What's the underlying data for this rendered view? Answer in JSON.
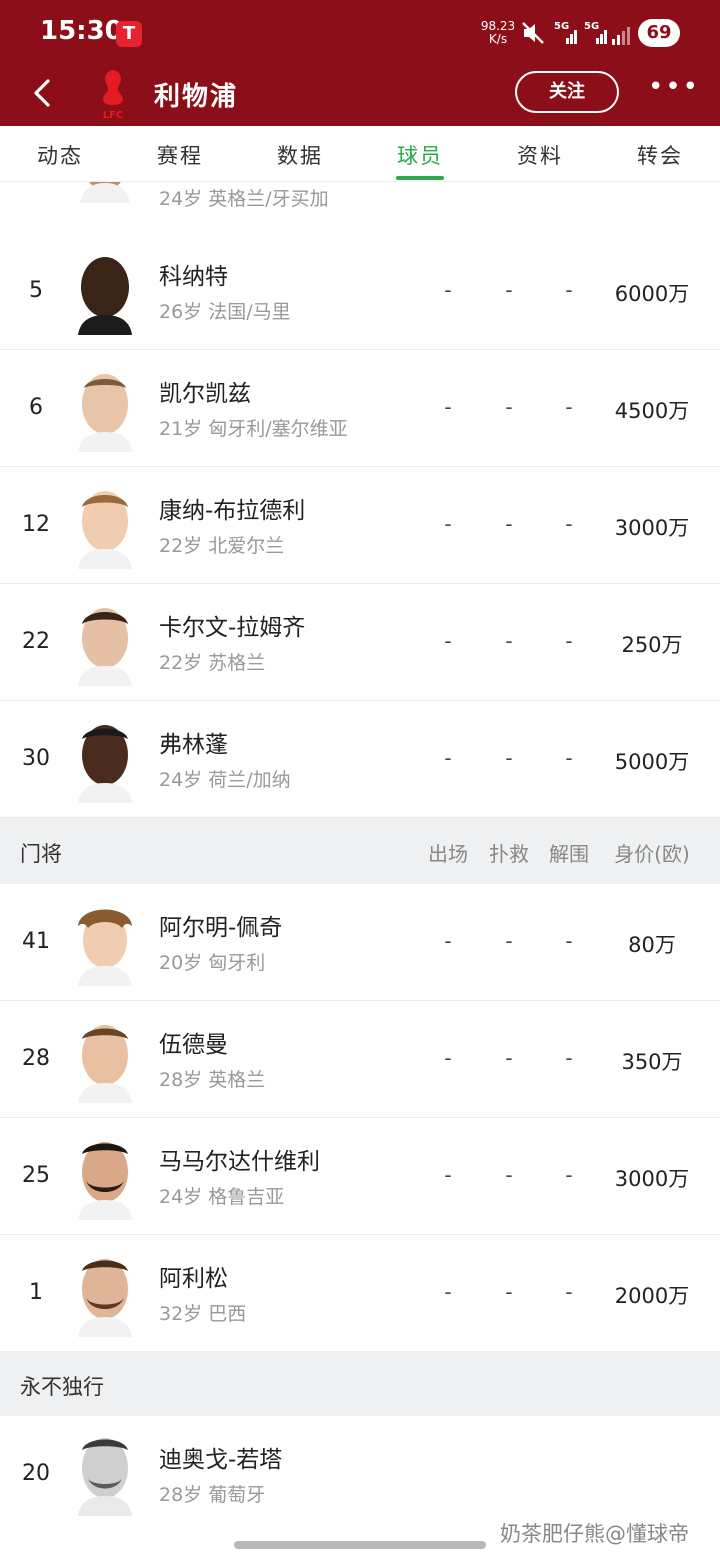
{
  "status_bar": {
    "time": "15:30",
    "speed_value": "98.23",
    "speed_unit": "K/s",
    "network1": "5G",
    "network2": "5G",
    "battery": "69"
  },
  "header": {
    "club_name": "利物浦",
    "follow_label": "关注",
    "more_label": "•••",
    "logo_text": "LFC"
  },
  "tabs": [
    {
      "label": "动态"
    },
    {
      "label": "赛程"
    },
    {
      "label": "数据"
    },
    {
      "label": "球员"
    },
    {
      "label": "资料"
    },
    {
      "label": "转会"
    }
  ],
  "partial_row": {
    "sub": "24岁 英格兰/牙买加"
  },
  "defenders": [
    {
      "number": "5",
      "name": "科纳特",
      "sub": "26岁 法国/马里",
      "apps": "-",
      "saves": "-",
      "clearances": "-",
      "value": "6000万"
    },
    {
      "number": "6",
      "name": "凯尔凯兹",
      "sub": "21岁 匈牙利/塞尔维亚",
      "apps": "-",
      "saves": "-",
      "clearances": "-",
      "value": "4500万"
    },
    {
      "number": "12",
      "name": "康纳-布拉德利",
      "sub": "22岁 北爱尔兰",
      "apps": "-",
      "saves": "-",
      "clearances": "-",
      "value": "3000万"
    },
    {
      "number": "22",
      "name": "卡尔文-拉姆齐",
      "sub": "22岁 苏格兰",
      "apps": "-",
      "saves": "-",
      "clearances": "-",
      "value": "250万"
    },
    {
      "number": "30",
      "name": "弗林蓬",
      "sub": "24岁 荷兰/加纳",
      "apps": "-",
      "saves": "-",
      "clearances": "-",
      "value": "5000万"
    }
  ],
  "goalkeeper_section": {
    "title": "门将",
    "columns": [
      "出场",
      "扑救",
      "解围",
      "身价(欧)"
    ]
  },
  "goalkeepers": [
    {
      "number": "41",
      "name": "阿尔明-佩奇",
      "sub": "20岁 匈牙利",
      "apps": "-",
      "saves": "-",
      "clearances": "-",
      "value": "80万"
    },
    {
      "number": "28",
      "name": "伍德曼",
      "sub": "28岁 英格兰",
      "apps": "-",
      "saves": "-",
      "clearances": "-",
      "value": "350万"
    },
    {
      "number": "25",
      "name": "马马尔达什维利",
      "sub": "24岁 格鲁吉亚",
      "apps": "-",
      "saves": "-",
      "clearances": "-",
      "value": "3000万"
    },
    {
      "number": "1",
      "name": "阿利松",
      "sub": "32岁 巴西",
      "apps": "-",
      "saves": "-",
      "clearances": "-",
      "value": "2000万"
    }
  ],
  "memorial_section": {
    "title": "永不独行"
  },
  "memorial": [
    {
      "number": "20",
      "name": "迪奥戈-若塔",
      "sub": "28岁 葡萄牙"
    }
  ],
  "watermark": "奶茶肥仔熊@懂球帝",
  "colors": {
    "brand": "#8c0e19",
    "active_tab": "#2ea84a",
    "section_bg": "#eef0f2"
  }
}
